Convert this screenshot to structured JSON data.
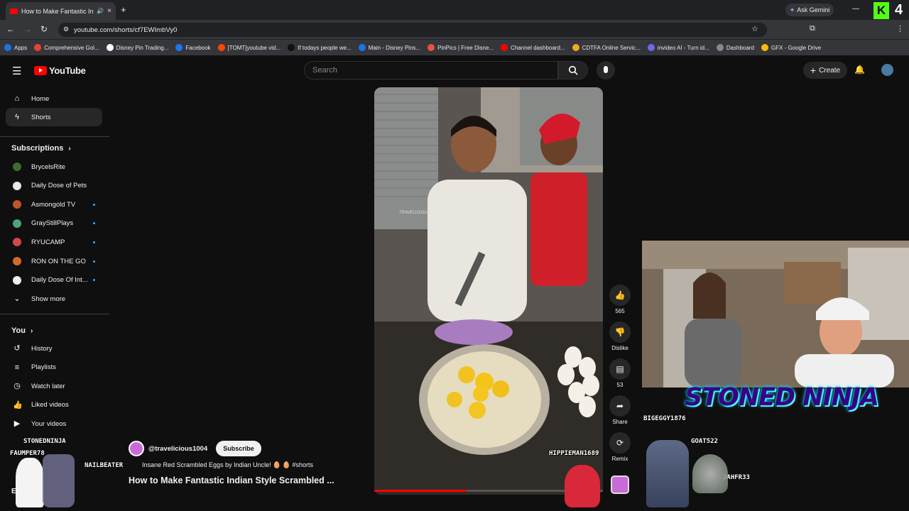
{
  "browser": {
    "tab_title": "How to Make Fantastic Indi",
    "url": "youtube.com/shorts/cf7EWImbVy0",
    "ask_gemini": "Ask Gemini",
    "bookmarks": [
      "Apps",
      "Comprehensive Gol...",
      "Disney Pin Trading...",
      "Facebook",
      "[TOMT]youtube vid...",
      "If todays people we...",
      "Main - Disney Pins...",
      "PinPics | Free Disne...",
      "Channel dashboard...",
      "CDTFA Online Servic...",
      "invideo AI - Turn id...",
      "Dashboard",
      "GFX - Google Drive"
    ]
  },
  "header": {
    "logo": "YouTube",
    "search_placeholder": "Search",
    "create": "Create"
  },
  "sidebar": {
    "home": "Home",
    "shorts": "Shorts",
    "subscriptions_title": "Subscriptions",
    "subscriptions": [
      {
        "name": "BrycelsRite",
        "color": "#3d6b2d",
        "live": false
      },
      {
        "name": "Daily Dose of Pets",
        "color": "#e8e8e8",
        "live": false
      },
      {
        "name": "Asmongold TV",
        "color": "#c0542a",
        "live": true
      },
      {
        "name": "GrayStillPlays",
        "color": "#4aa37a",
        "live": true
      },
      {
        "name": "RYUCAMP",
        "color": "#d04a4a",
        "live": true
      },
      {
        "name": "RON ON THE GO",
        "color": "#d06a2a",
        "live": true
      },
      {
        "name": "Daily Dose Of Int...",
        "color": "#f0f0f0",
        "live": true
      }
    ],
    "show_more": "Show more",
    "you_title": "You",
    "you_items": [
      "History",
      "Playlists",
      "Watch later",
      "Liked videos",
      "Your videos"
    ],
    "explore_partial": "Exp"
  },
  "short": {
    "likes": "565",
    "dislike": "Dislike",
    "comments": "53",
    "share": "Share",
    "remix": "Remix",
    "watermark": "TRAVELICIOUS",
    "channel": "@travelicious1004",
    "subscribe": "Subscribe",
    "music": "Insane Red Scrambled Eggs by Indian Uncle! 🥚 🥚 #shorts",
    "title": "How to Make Fantastic Indian Style Scrambled ..."
  },
  "overlay": {
    "stream_title": "STONED NINJA",
    "chat_names": [
      "BIGEGGY1876",
      "GOAT522",
      "JAHFR33",
      "HIPPIEMAN1689",
      "NAILBEATER",
      "STONEDNINJA",
      "FAUMPER78"
    ],
    "tilt_counter": "4"
  }
}
